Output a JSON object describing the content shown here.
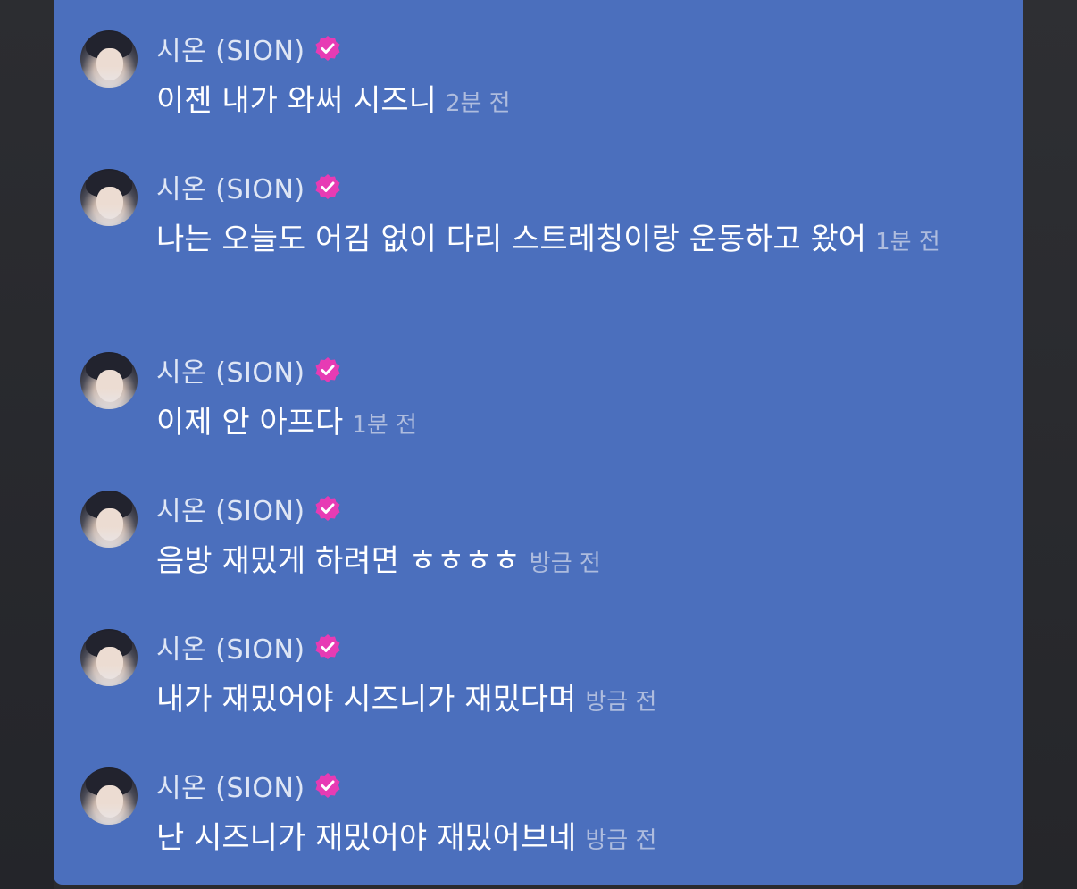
{
  "chat": {
    "accent_color": "#4b6fbd",
    "badge_color": "#e73bb4",
    "messages": [
      {
        "author": "시온 (SION)",
        "text": "이젠 내가 와써 시즈니",
        "time": "2분 전"
      },
      {
        "author": "시온 (SION)",
        "text": "나는 오늘도 어김 없이 다리 스트레칭이랑 운동하고 왔어",
        "time": "1분 전"
      },
      {
        "author": "시온 (SION)",
        "text": "이제 안 아프다",
        "time": "1분 전"
      },
      {
        "author": "시온 (SION)",
        "text": "음방 재밌게 하려면 ㅎㅎㅎㅎ",
        "time": "방금 전"
      },
      {
        "author": "시온 (SION)",
        "text": "내가 재밌어야 시즈니가 재밌다며",
        "time": "방금 전"
      },
      {
        "author": "시온 (SION)",
        "text": "난 시즈니가 재밌어야 재밌어브네",
        "time": "방금 전"
      }
    ]
  }
}
